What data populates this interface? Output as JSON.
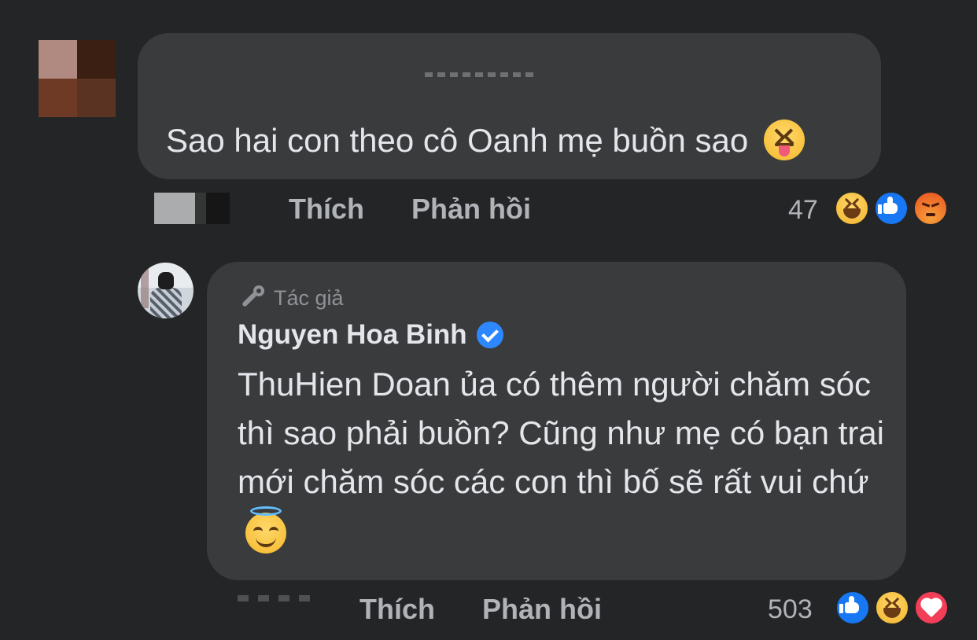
{
  "comment1": {
    "text": "Sao hai con theo cô Oanh mẹ buồn sao",
    "emoji": "squinting-tongue-emoji",
    "actions": {
      "like_label": "Thích",
      "reply_label": "Phản hồi"
    },
    "reaction_count": "47",
    "reactions": [
      "haha",
      "like",
      "angry"
    ]
  },
  "reply": {
    "author_badge": "Tác giả",
    "author_name": "Nguyen Hoa Binh",
    "verified": true,
    "text": "ThuHien Doan ủa có thêm người chăm sóc thì sao phải buồn? Cũng như mẹ có bạn trai mới chăm sóc các con thì bố sẽ rất vui chứ",
    "emoji": "smiling-halo-emoji",
    "actions": {
      "like_label": "Thích",
      "reply_label": "Phản hồi"
    },
    "reaction_count": "503",
    "reactions": [
      "like",
      "haha",
      "love"
    ]
  },
  "colors": {
    "background": "#242526",
    "bubble": "#3a3b3c",
    "text_primary": "#e4e6eb",
    "text_secondary": "#b0b3b8",
    "like_blue": "#1877f2",
    "love_red": "#f33e58"
  }
}
